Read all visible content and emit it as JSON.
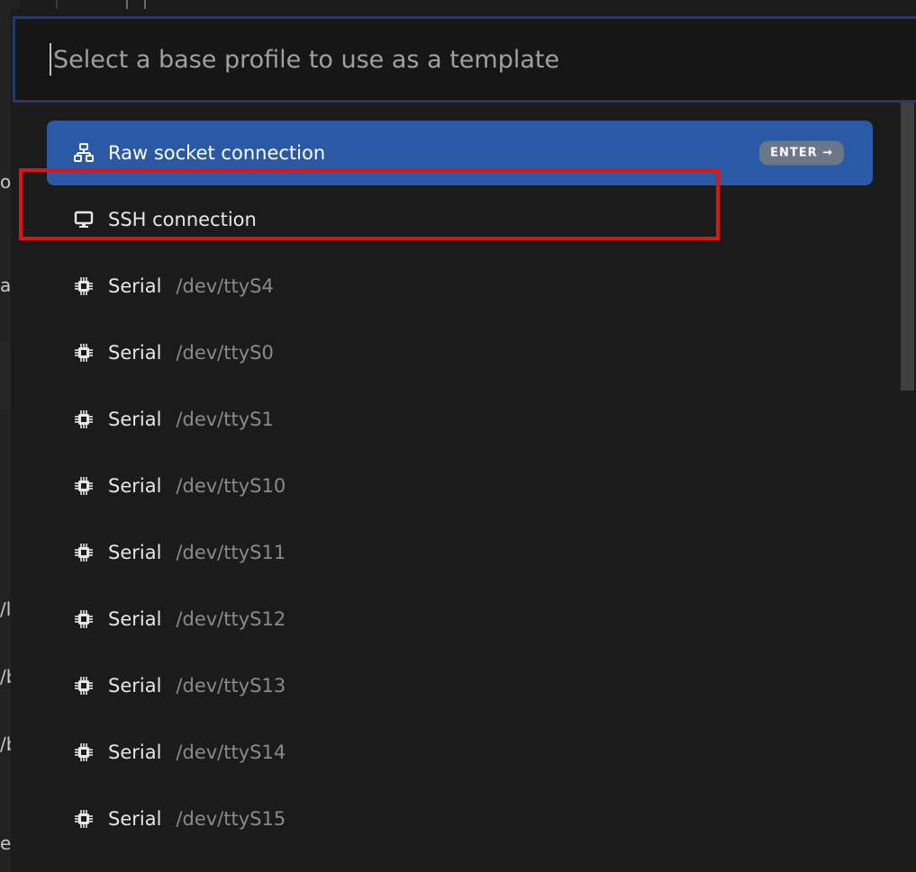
{
  "search": {
    "placeholder": "Select a base profile to use as a template",
    "value": ""
  },
  "items": [
    {
      "label": "Raw socket connection",
      "description": "",
      "icon": "network-icon",
      "selected": true,
      "badge": "ENTER →"
    },
    {
      "label": "SSH connection",
      "description": "",
      "icon": "desktop-icon",
      "selected": false
    },
    {
      "label": "Serial",
      "description": "/dev/ttyS4",
      "icon": "chip-icon",
      "selected": false
    },
    {
      "label": "Serial",
      "description": "/dev/ttyS0",
      "icon": "chip-icon",
      "selected": false
    },
    {
      "label": "Serial",
      "description": "/dev/ttyS1",
      "icon": "chip-icon",
      "selected": false
    },
    {
      "label": "Serial",
      "description": "/dev/ttyS10",
      "icon": "chip-icon",
      "selected": false
    },
    {
      "label": "Serial",
      "description": "/dev/ttyS11",
      "icon": "chip-icon",
      "selected": false
    },
    {
      "label": "Serial",
      "description": "/dev/ttyS12",
      "icon": "chip-icon",
      "selected": false
    },
    {
      "label": "Serial",
      "description": "/dev/ttyS13",
      "icon": "chip-icon",
      "selected": false
    },
    {
      "label": "Serial",
      "description": "/dev/ttyS14",
      "icon": "chip-icon",
      "selected": false
    },
    {
      "label": "Serial",
      "description": "/dev/ttyS15",
      "icon": "chip-icon",
      "selected": false
    }
  ],
  "background_fragments": [
    "o",
    "ab",
    "/l",
    "/b",
    "/b",
    "et"
  ],
  "colors": {
    "selected_bg": "#2a5aa6",
    "highlight_border": "#e01414",
    "badge_bg": "#6b7788",
    "search_border": "#253a63"
  }
}
